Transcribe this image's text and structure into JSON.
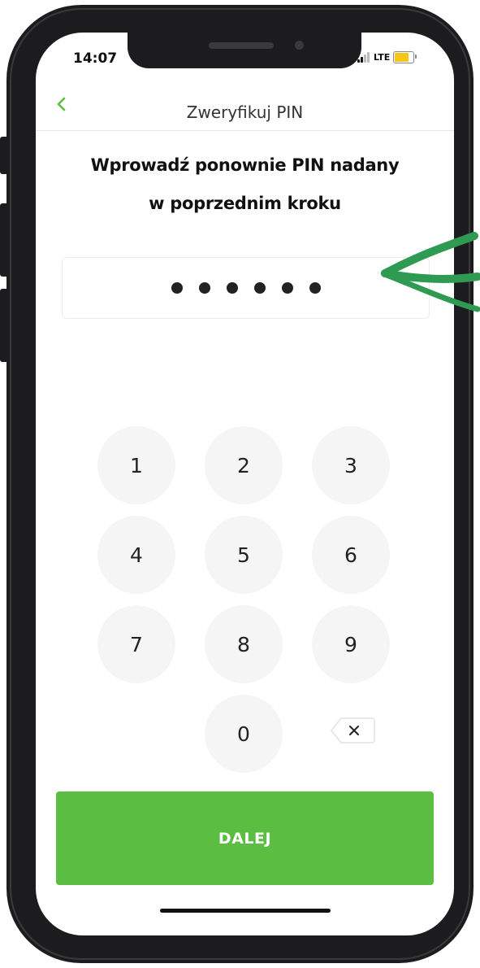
{
  "status_bar": {
    "time": "14:07",
    "network": "LTE",
    "battery_color": "#f5c518"
  },
  "header": {
    "back_icon": "chevron-left-icon",
    "title": "Zweryfikuj PIN"
  },
  "main": {
    "heading_line1": "Wprowadź ponownie PIN nadany",
    "heading_line2": "w poprzednim kroku",
    "pin": {
      "masked_length": 6,
      "filled_digits": 6
    }
  },
  "keypad": {
    "keys": [
      "1",
      "2",
      "3",
      "4",
      "5",
      "6",
      "7",
      "8",
      "9",
      "0"
    ],
    "delete_label": "×"
  },
  "cta": {
    "label": "DALEJ"
  },
  "colors": {
    "accent": "#5bbd41",
    "annotation_arrow": "#2e9a52",
    "key_background": "#f5f5f5"
  }
}
